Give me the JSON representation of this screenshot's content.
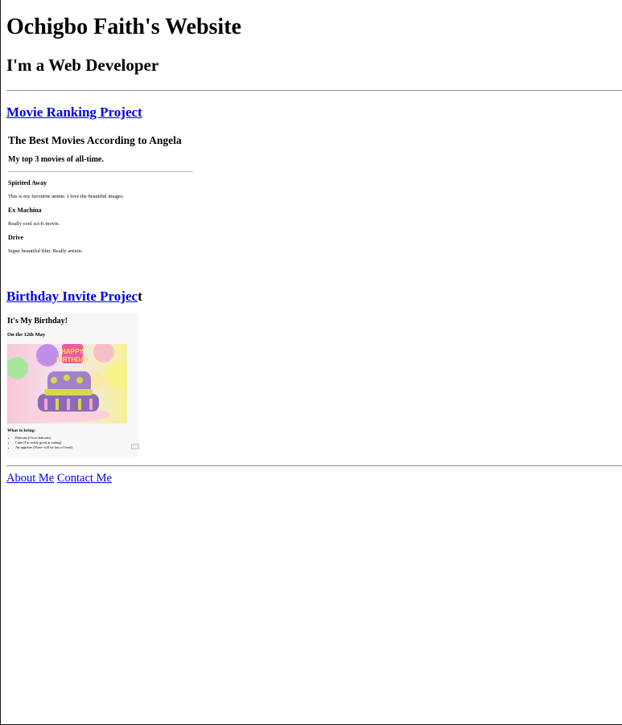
{
  "header": {
    "title": "Ochigbo Faith's Website",
    "subtitle": "I'm a Web Developer"
  },
  "projects": [
    {
      "link_label": "Movie Ranking Project",
      "suffix": "",
      "preview": {
        "heading": "The Best Movies According to Angela",
        "subheading": "My top 3 movies of all-time.",
        "items": [
          {
            "title": "Spirited Away",
            "desc": "This is my favourite anime. I love the beautiful images."
          },
          {
            "title": "Ex Machina",
            "desc": "Really cool sci-fi movie."
          },
          {
            "title": "Drive",
            "desc": "Super beautiful film. Really artistic."
          }
        ]
      }
    },
    {
      "link_label": "Birthday Invite Projec",
      "suffix": "t",
      "preview": {
        "heading": "It's My Birthday!",
        "subheading": "On the 12th May",
        "image_alt": "birthday-cake-image",
        "bring_label": "What to bring:",
        "bring_items": [
          "Baloons (I love baloons)",
          "Cake (I'm really good at eating)",
          "An appetite (There will be lots of food)"
        ]
      }
    }
  ],
  "footer": {
    "about_label": "About Me",
    "contact_label": "Contact Me"
  },
  "colors": {
    "link": "#0000ee",
    "rule": "#8a8a8a"
  }
}
